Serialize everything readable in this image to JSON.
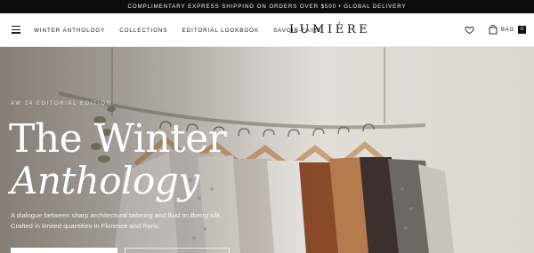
{
  "announcement": "COMPLIMENTARY EXPRESS SHIPPING ON ORDERS OVER $500 • GLOBAL DELIVERY",
  "nav": {
    "items": [
      "WINTER ANTHOLOGY",
      "COLLECTIONS",
      "EDITORIAL LOOKBOOK",
      "SAVOIR-FAIRE"
    ]
  },
  "brand": "LUMIÈRE",
  "header": {
    "bag_label": "BAG",
    "bag_count": "0"
  },
  "hero": {
    "kicker": "AW 24 EDITORIAL EDITION",
    "title_line1": "The Winter",
    "title_line2": "Anthology",
    "description": "A dialogue between sharp architectural tailoring and fluid mulberry silk. Crafted in limited quantities in Florence and Paris."
  },
  "colors": {
    "announcement_bg": "#0d0d0d",
    "header_bg": "#ffffff",
    "hero_text": "#ffffff"
  },
  "icons": {
    "menu": "hamburger-menu-icon",
    "wishlist": "heart-icon",
    "bag": "shopping-bag-icon"
  }
}
